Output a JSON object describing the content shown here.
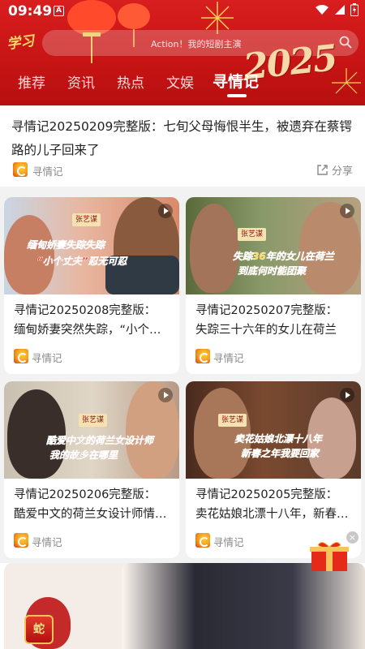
{
  "status_bar": {
    "time": "09:49",
    "notification_glyph": "A"
  },
  "header": {
    "logo_text": "学习",
    "search_placeholder": "Action！我的短剧主演",
    "year_text": "2025",
    "tabs": [
      {
        "label": "推荐",
        "active": false
      },
      {
        "label": "资讯",
        "active": false
      },
      {
        "label": "热点",
        "active": false
      },
      {
        "label": "文娱",
        "active": false
      },
      {
        "label": "寻情记",
        "active": true
      }
    ]
  },
  "top_article": {
    "title": "寻情记20250209完整版：七旬父母悔恨半生，被遗弃在蔡锷路的儿子回来了",
    "channel": "寻情记",
    "share_label": "分享"
  },
  "cards": [
    {
      "title_line1": "寻情记20250208完整版：",
      "title_line2": "缅甸娇妻突然失踪，“小个子丈夫”忍无可忍",
      "channel": "寻情记",
      "thumb_caption1": "缅甸娇妻失踪失踪",
      "thumb_caption2": "“小个丈夫”忍无可忍",
      "host_badge": "张艺谋"
    },
    {
      "title_line1": "寻情记20250207完整版：",
      "title_line2": "失踪三十六年的女儿在荷兰",
      "channel": "寻情记",
      "thumb_caption1": "失踪36年的女儿在荷兰",
      "thumb_caption2": "到底何时能团聚",
      "host_badge": "张艺谋"
    },
    {
      "title_line1": "寻情记20250206完整版：",
      "title_line2": "酷爱中文的荷兰女设计师情系故乡",
      "channel": "寻情记",
      "thumb_caption1": "酷爱中文的荷兰女设计师",
      "thumb_caption2": "我的故乡在哪里",
      "host_badge": "张艺谋"
    },
    {
      "title_line1": "寻情记20250205完整版：",
      "title_line2": "卖花姑娘北漂十八年，新春之年我要回家",
      "channel": "寻情记",
      "thumb_caption1": "卖花姑娘北漂十八年",
      "thumb_caption2": "新春之年我要回家",
      "host_badge": "张艺谋"
    }
  ],
  "floating_button_text": "蛇",
  "colors": {
    "brand_red": "#d81e1e",
    "accent_gold": "#f5c45a",
    "text_dark": "#222222",
    "text_gray": "#888888"
  }
}
